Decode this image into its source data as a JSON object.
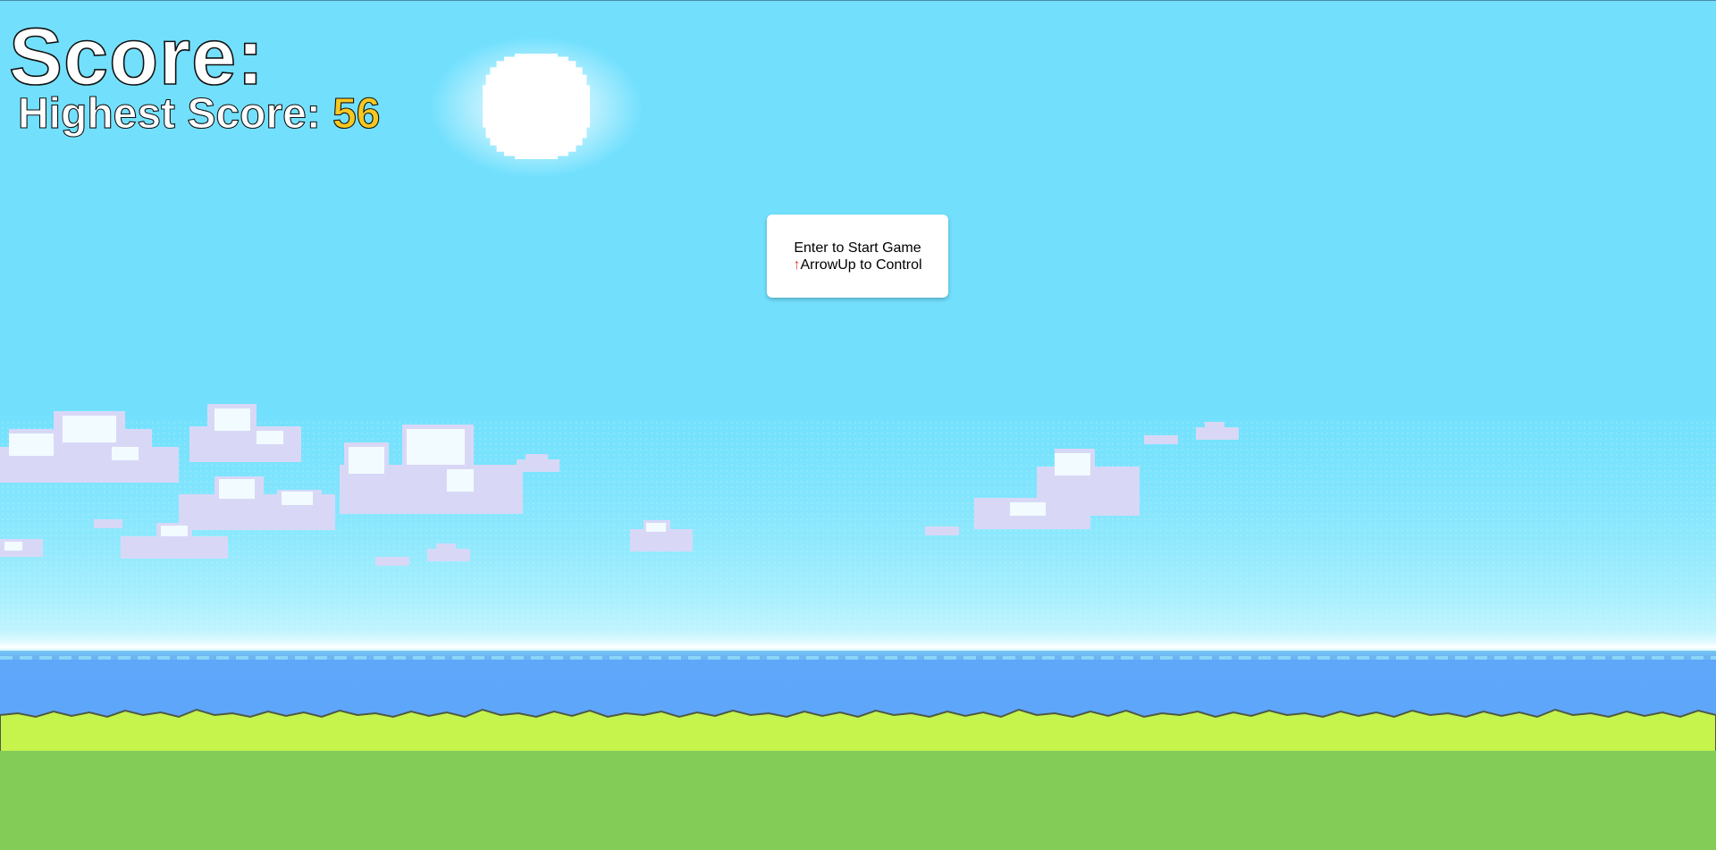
{
  "hud": {
    "score_label": "Score:",
    "highest_label": "Highest Score: ",
    "highest_value": "56",
    "highest_value_color": "#f7c820"
  },
  "dialog": {
    "line1": "Enter to Start Game",
    "arrow": "↑",
    "line2": "ArrowUp to Control",
    "arrow_color": "#e23a2a"
  },
  "scene": {
    "sky_color": "#72e0fd",
    "sea_color": "#5ea6fb",
    "grass_color": "#c6f34c",
    "ground_color": "#83cc58",
    "icons": [
      "sun-icon",
      "cloud-icon"
    ]
  }
}
